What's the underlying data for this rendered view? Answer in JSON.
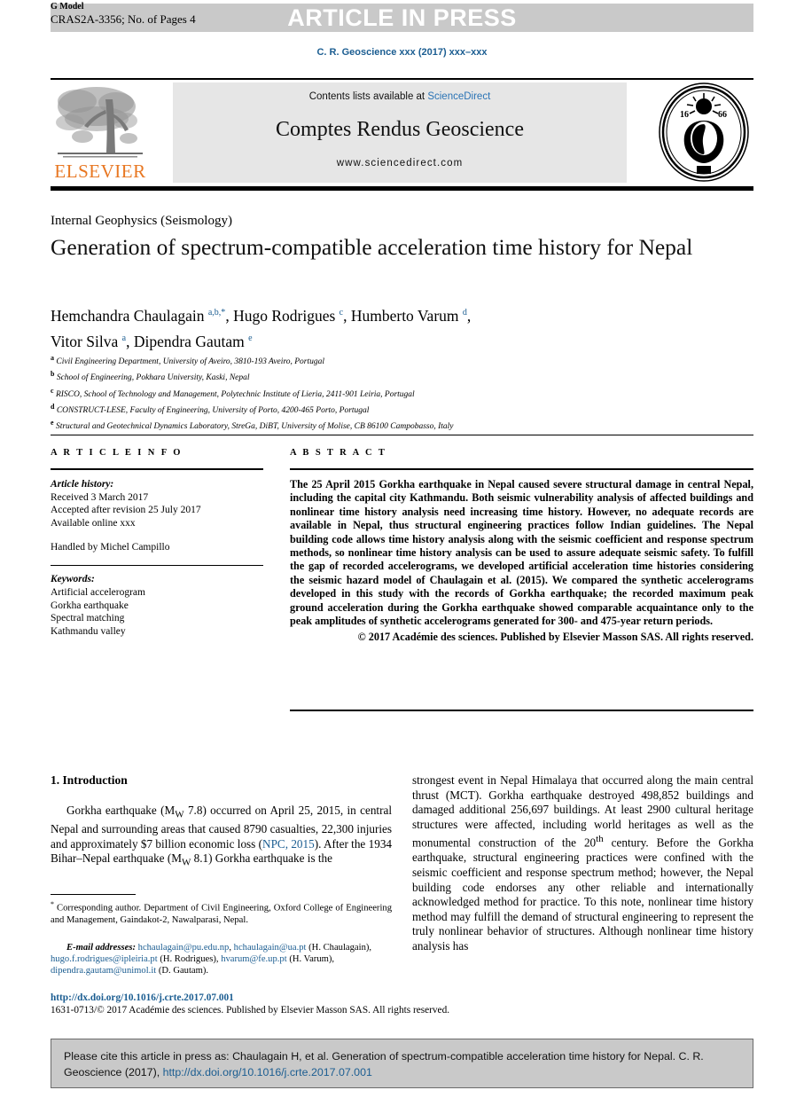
{
  "header": {
    "gmodel_label": "G Model",
    "article_id": "CRAS2A-3356; No. of Pages 4",
    "press_banner": "ARTICLE IN PRESS",
    "running_head": "C. R. Geoscience xxx (2017) xxx–xxx"
  },
  "masthead": {
    "contents_prefix": "Contents lists available at ",
    "contents_link": "ScienceDirect",
    "journal_title": "Comptes Rendus Geoscience",
    "journal_url": "www.sciencedirect.com",
    "publisher_name": "ELSEVIER",
    "seal_name": "academie-des-sciences-seal"
  },
  "article": {
    "subject_area": "Internal Geophysics (Seismology)",
    "title": "Generation of spectrum-compatible acceleration time history for Nepal",
    "authors_line_1_a": "Hemchandra Chaulagain ",
    "authors_line_1_a_sup": "a,b,*",
    "authors_line_1_b": ", Hugo Rodrigues ",
    "authors_line_1_b_sup": "c",
    "authors_line_1_c": ", Humberto Varum ",
    "authors_line_1_c_sup": "d",
    "authors_line_1_d": ",",
    "authors_line_2_a": "Vitor Silva ",
    "authors_line_2_a_sup": "a",
    "authors_line_2_b": ", Dipendra Gautam ",
    "authors_line_2_b_sup": "e",
    "affiliations": [
      {
        "mark": "a",
        "text": "Civil Engineering Department, University of Aveiro, 3810-193 Aveiro, Portugal"
      },
      {
        "mark": "b",
        "text": "School of Engineering, Pokhara University, Kaski, Nepal"
      },
      {
        "mark": "c",
        "text": "RISCO, School of Technology and Management, Polytechnic Institute of Lieria, 2411-901 Leiria, Portugal"
      },
      {
        "mark": "d",
        "text": "CONSTRUCT-LESE, Faculty of Engineering, University of Porto, 4200-465 Porto, Portugal"
      },
      {
        "mark": "e",
        "text": "Structural and Geotechnical Dynamics Laboratory, StreGa, DiBT, University of Molise, CB 86100 Campobasso, Italy"
      }
    ]
  },
  "info": {
    "heading": "A R T I C L E   I N F O",
    "history_label": "Article history:",
    "received": "Received 3 March 2017",
    "accepted": "Accepted after revision 25 July 2017",
    "available": "Available online xxx",
    "handled_by": "Handled by Michel Campillo",
    "keywords_label": "Keywords:",
    "keywords": [
      "Artificial accelerogram",
      "Gorkha earthquake",
      "Spectral matching",
      "Kathmandu valley"
    ]
  },
  "abstract": {
    "heading": "A B S T R A C T",
    "body": "The 25 April 2015 Gorkha earthquake in Nepal caused severe structural damage in central Nepal, including the capital city Kathmandu. Both seismic vulnerability analysis of affected buildings and nonlinear time history analysis need increasing time history. However, no adequate records are available in Nepal, thus structural engineering practices follow Indian guidelines. The Nepal building code allows time history analysis along with the seismic coefficient and response spectrum methods, so nonlinear time history analysis can be used to assure adequate seismic safety. To fulfill the gap of recorded accelerograms, we developed artificial acceleration time histories considering the seismic hazard model of Chaulagain et al. (2015). We compared the synthetic accelerograms developed in this study with the records of Gorkha earthquake; the recorded maximum peak ground acceleration during the Gorkha earthquake showed comparable acquaintance only to the peak amplitudes of synthetic accelerograms generated for 300- and 475-year return periods.",
    "copyright": "© 2017 Académie des sciences. Published by Elsevier Masson SAS. All rights reserved."
  },
  "body": {
    "section_title": "1. Introduction",
    "left_par_1": "Gorkha earthquake (M",
    "left_par_1_sub": "W",
    "left_par_1_b": " 7.8) occurred on April 25, 2015, in central Nepal and surrounding areas that caused 8790 casualties, 22,300 injuries and approximately $7 billion economic loss (",
    "left_par_1_link": "NPC, 2015",
    "left_par_1_c": "). After the 1934 Bihar–Nepal earthquake (M",
    "left_par_1_sub2": "W",
    "left_par_1_d": " 8.1) Gorkha earthquake is the",
    "right_par_1a": "strongest event in Nepal Himalaya that occurred along the main central thrust (MCT). Gorkha earthquake destroyed 498,852 buildings and damaged additional 256,697 buildings. At least 2900 cultural heritage structures were affected, including world heritages as well as the monumental construction of the 20",
    "right_par_1_sup": "th",
    "right_par_1b": " century. Before the Gorkha earthquake, structural engineering practices were confined with the seismic coefficient and response spectrum method; however, the Nepal building code endorses any other reliable and internationally acknowledged method for practice. To this note, nonlinear time history method may fulfill the demand of structural engineering to represent the truly nonlinear behavior of structures. Although nonlinear time history analysis has"
  },
  "footer": {
    "corresponding_star": "*",
    "corresponding_text": " Corresponding author. Department of Civil Engineering, Oxford College of Engineering and Management, Gaindakot-2, Nawalparasi, Nepal.",
    "email_label": "E-mail addresses:",
    "email_1": "hchaulagain@pu.edu.np",
    "email_2": "hchaulagain@ua.pt",
    "email_1_owner": "(H. Chaulagain),",
    "email_3": "hugo.f.rodrigues@ipleiria.pt",
    "email_3_owner": "(H. Rodrigues),",
    "email_4": "hvarum@fe.up.pt",
    "email_4_owner": "(H. Varum),",
    "email_5": "dipendra.gautam@unimol.it",
    "email_5_owner": "(D. Gautam).",
    "doi": "http://dx.doi.org/10.1016/j.crte.2017.07.001",
    "issn_line": "1631-0713/© 2017 Académie des sciences. Published by Elsevier Masson SAS. All rights reserved."
  },
  "cite_box": {
    "text_before": "Please cite this article in press as: Chaulagain H, et al. Generation of spectrum-compatible acceleration time history for Nepal. C. R. Geoscience (2017), ",
    "link": "http://dx.doi.org/10.1016/j.crte.2017.07.001"
  },
  "colors": {
    "link_blue": "#1b5d91",
    "sciencedirect_blue": "#2a73b5",
    "elsevier_orange": "#E87722",
    "band_gray": "#c9c9c9",
    "panel_gray": "#e6e6e6"
  }
}
